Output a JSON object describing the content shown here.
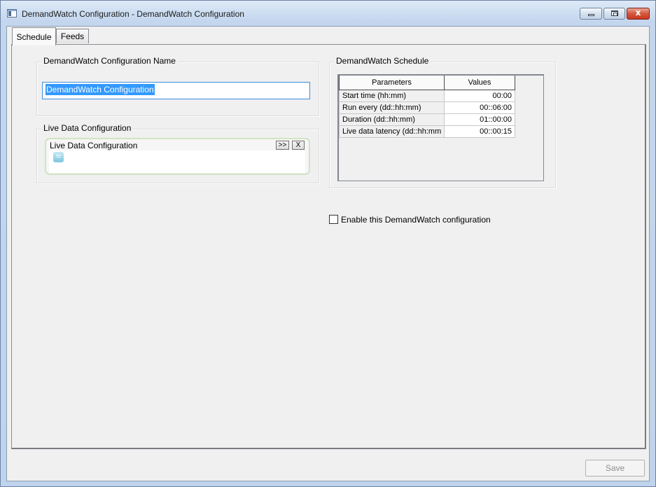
{
  "window": {
    "title": "DemandWatch Configuration - DemandWatch Configuration",
    "close_glyph": "x"
  },
  "tabs": [
    {
      "label": "Schedule",
      "active": true
    },
    {
      "label": "Feeds",
      "active": false
    }
  ],
  "config_name": {
    "group_title": "DemandWatch Configuration Name",
    "value": "DemandWatch Configuration"
  },
  "live_data": {
    "group_title": "Live Data Configuration",
    "panel_title": "Live Data Configuration",
    "expand_label": ">>",
    "remove_label": "X",
    "item_icon": "data-feed-icon"
  },
  "schedule": {
    "group_title": "DemandWatch Schedule",
    "columns": [
      "Parameters",
      "Values"
    ],
    "rows": [
      {
        "parameter": "Start time (hh:mm)",
        "value": "00:00"
      },
      {
        "parameter": "Run every (dd::hh:mm)",
        "value": "00::06:00"
      },
      {
        "parameter": "Duration (dd::hh:mm)",
        "value": "01::00:00"
      },
      {
        "parameter": "Live data latency (dd::hh:mm",
        "value": "00::00:15"
      }
    ]
  },
  "enable": {
    "label": "Enable this DemandWatch configuration",
    "checked": false
  },
  "footer": {
    "save_label": "Save",
    "save_enabled": false
  }
}
